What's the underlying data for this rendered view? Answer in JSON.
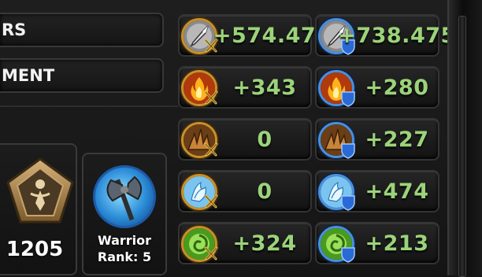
{
  "labels": {
    "row1": "RS",
    "row2": "MENT"
  },
  "rating": {
    "value": "1205",
    "icon": "pentagon-rank-emblem-icon"
  },
  "class_badge": {
    "name": "Warrior",
    "rank": "Rank: 5",
    "icon": "warrior-axe-icon"
  },
  "colors": {
    "value_green": "#9bd37a",
    "attack_ring": "#c98f2a",
    "defense_ring": "#4a8fe0"
  },
  "stats": [
    {
      "type": "physical",
      "attack": "+574.47",
      "defense": "+738.475"
    },
    {
      "type": "fire",
      "attack": "+343",
      "defense": "+280"
    },
    {
      "type": "earth",
      "attack": "0",
      "defense": "+227"
    },
    {
      "type": "ice",
      "attack": "0",
      "defense": "+474"
    },
    {
      "type": "nature",
      "attack": "+324",
      "defense": "+213"
    }
  ]
}
